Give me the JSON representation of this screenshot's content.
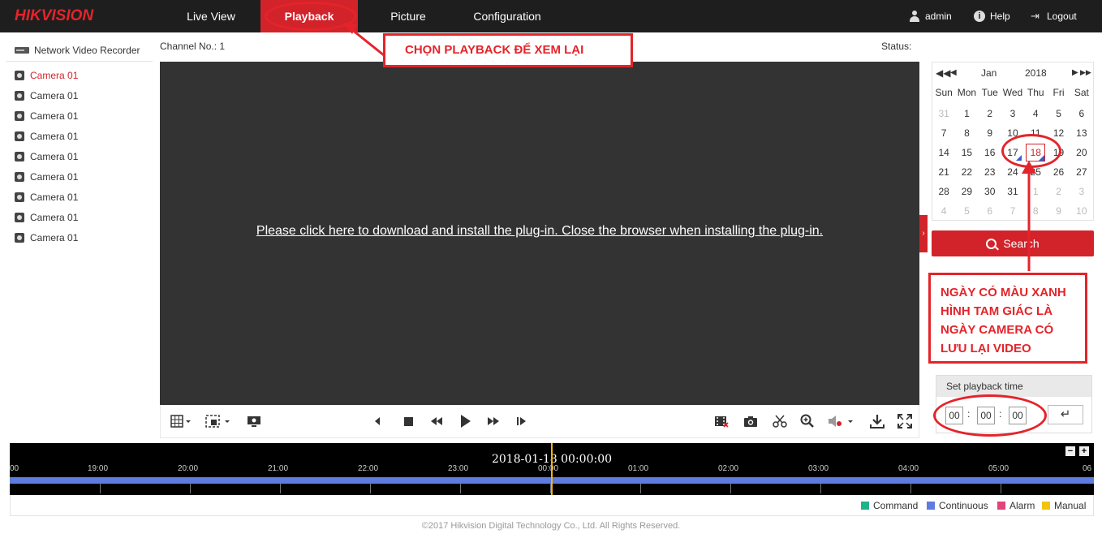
{
  "nav": {
    "logo": "HIKVISION",
    "tabs": {
      "live": "Live View",
      "playback": "Playback",
      "picture": "Picture",
      "config": "Configuration"
    },
    "user": "admin",
    "help": "Help",
    "logout": "Logout"
  },
  "left": {
    "header": "Network Video Recorder",
    "cameras": [
      "Camera 01",
      "Camera 01",
      "Camera 01",
      "Camera 01",
      "Camera 01",
      "Camera 01",
      "Camera 01",
      "Camera 01",
      "Camera 01"
    ]
  },
  "main": {
    "channel_no": "Channel No.: 1",
    "status": "Status:",
    "plugin_msg": "Please click here to download and install the plug-in. Close the browser when installing the plug-in."
  },
  "calendar": {
    "month": "Jan",
    "year": "2018",
    "dow": [
      "Sun",
      "Mon",
      "Tue",
      "Wed",
      "Thu",
      "Fri",
      "Sat"
    ],
    "weeks": [
      [
        "31",
        "1",
        "2",
        "3",
        "4",
        "5",
        "6"
      ],
      [
        "7",
        "8",
        "9",
        "10",
        "11",
        "12",
        "13"
      ],
      [
        "14",
        "15",
        "16",
        "17",
        "18",
        "19",
        "20"
      ],
      [
        "21",
        "22",
        "23",
        "24",
        "25",
        "26",
        "27"
      ],
      [
        "28",
        "29",
        "30",
        "31",
        "1",
        "2",
        "3"
      ],
      [
        "4",
        "5",
        "6",
        "7",
        "8",
        "9",
        "10"
      ]
    ],
    "selected": "18"
  },
  "search": {
    "label": "Search"
  },
  "playback_time": {
    "title": "Set playback time",
    "hh": "00",
    "mm": "00",
    "ss": "00",
    "go": "↵"
  },
  "timeline": {
    "date": "2018-01-18 00:00:00",
    "hours": [
      "00",
      "19:00",
      "20:00",
      "21:00",
      "22:00",
      "23:00",
      "00:00",
      "01:00",
      "02:00",
      "03:00",
      "04:00",
      "05:00",
      "06"
    ],
    "zoom_out": "−",
    "zoom_in": "+"
  },
  "legend": {
    "items": [
      {
        "label": "Command",
        "color": "#1fb38a"
      },
      {
        "label": "Continuous",
        "color": "#5e7be0"
      },
      {
        "label": "Alarm",
        "color": "#e2437a"
      },
      {
        "label": "Manual",
        "color": "#f2c40f"
      }
    ]
  },
  "footer": "©2017 Hikvision Digital Technology Co., Ltd. All Rights Reserved.",
  "annotations": {
    "playback": "CHỌN PLAYBACK ĐỂ XEM LẠI",
    "calendar_lines": [
      "NGÀY CÓ MÀU XANH",
      "HÌNH TAM GIÁC LÀ",
      "NGÀY CAMERA CÓ",
      "LƯU LẠI VIDEO"
    ]
  }
}
